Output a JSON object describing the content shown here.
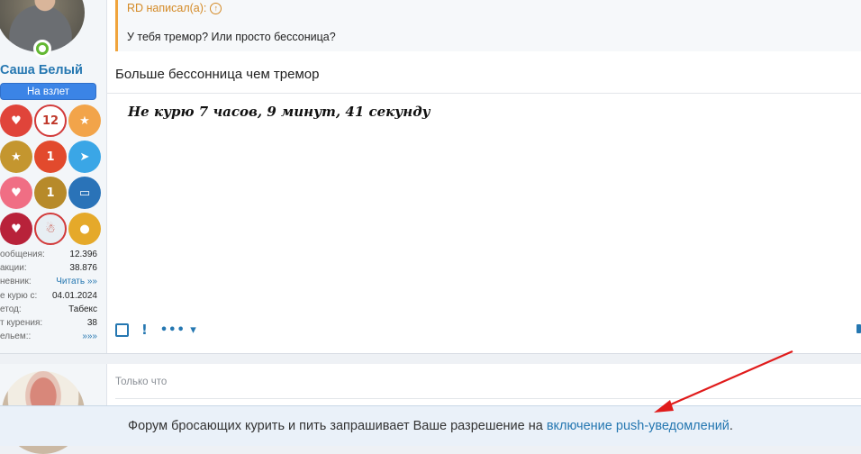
{
  "post1": {
    "user": {
      "name": "Саша Белый",
      "title": "На взлет"
    },
    "awards": [
      {
        "icon": "apple-award-icon",
        "color": "#e0443a",
        "glyph": "♥"
      },
      {
        "icon": "no-alcohol-12-award-icon",
        "color": "#ffffff",
        "glyph": "12"
      },
      {
        "icon": "chef-award-icon",
        "color": "#f2a44a",
        "glyph": "★"
      },
      {
        "icon": "runner-star-award-icon",
        "color": "#c4962f",
        "glyph": "★"
      },
      {
        "icon": "tomato-1-award-icon",
        "color": "#e24a2d",
        "glyph": "1"
      },
      {
        "icon": "telegram-award-icon",
        "color": "#3aa6e6",
        "glyph": "➤"
      },
      {
        "icon": "hearts-award-icon",
        "color": "#f06e84",
        "glyph": "♥"
      },
      {
        "icon": "trophy-1-award-icon",
        "color": "#b78a2a",
        "glyph": "1"
      },
      {
        "icon": "book-award-icon",
        "color": "#2a73b8",
        "glyph": "▭"
      },
      {
        "icon": "heart-award-icon",
        "color": "#b8223a",
        "glyph": "♥"
      },
      {
        "icon": "snowman-award-icon",
        "color": "#e8eef3",
        "glyph": "☃"
      },
      {
        "icon": "silhouette-award-icon",
        "color": "#e5a92a",
        "glyph": "●"
      }
    ],
    "stats": [
      {
        "label": "ообщения:",
        "value": "12.396"
      },
      {
        "label": "акции:",
        "value": "38.876"
      },
      {
        "label": "невник:",
        "value": "Читать »»",
        "link": true
      },
      {
        "label": "е курю с:",
        "value": "04.01.2024"
      },
      {
        "label": "етод:",
        "value": "Табекс"
      },
      {
        "label": "т курения:",
        "value": "38"
      },
      {
        "label": "ельем::",
        "value": "»»»",
        "link": true
      }
    ],
    "quote": {
      "author": "RD написал(а):",
      "text": "У тебя тремор? Или просто бессоница?"
    },
    "body": "Больше бессонница чем тремор",
    "signature": "Не курю  7 часов, 9 минут, 41 секунду",
    "actions": {
      "more": "•••"
    }
  },
  "post2": {
    "time": "Только что"
  },
  "notice": {
    "prefix": "Форум бросающих курить и пить запрашивает Ваше разрешение на ",
    "link": "включение push-уведомлений",
    "suffix": "."
  }
}
